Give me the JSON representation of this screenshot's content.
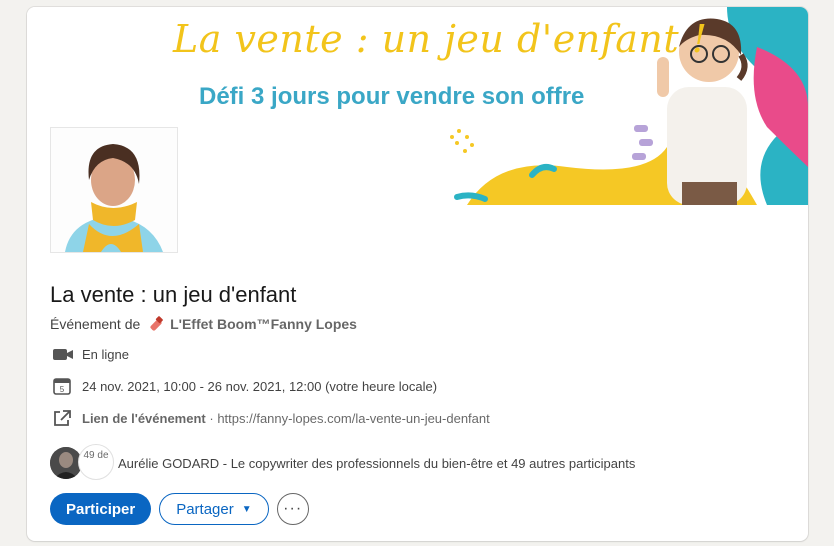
{
  "banner": {
    "title": "La vente : un jeu d'enfant !",
    "subtitle": "Défi 3 jours pour vendre son offre"
  },
  "event": {
    "title": "La vente : un jeu d'enfant",
    "organizer_prefix": "Événement de",
    "organizer_name": "L'Effet Boom™Fanny Lopes",
    "location": "En ligne",
    "datetime": "24 nov. 2021, 10:00 - 26 nov. 2021, 12:00 (votre heure locale)",
    "link_label": "Lien de l'événement",
    "link_separator": " · ",
    "link_url": "https://fanny-lopes.com/la-vente-un-jeu-denfant",
    "calendar_day": "5"
  },
  "attendees": {
    "count_badge": "49 de",
    "text": "Aurélie GODARD - Le copywriter des professionnels du bien-être et 49 autres participants"
  },
  "actions": {
    "participate": "Participer",
    "share": "Partager",
    "more": "···"
  },
  "icons": {
    "location": "video-camera-icon",
    "date": "calendar-icon",
    "link": "external-link-icon",
    "organizer": "lipstick-icon",
    "share_caret": "caret-down-icon",
    "more": "more-icon"
  },
  "colors": {
    "primary": "#0a66c2",
    "banner_title": "#f2c41b",
    "banner_subtitle": "#3aa7c6"
  }
}
